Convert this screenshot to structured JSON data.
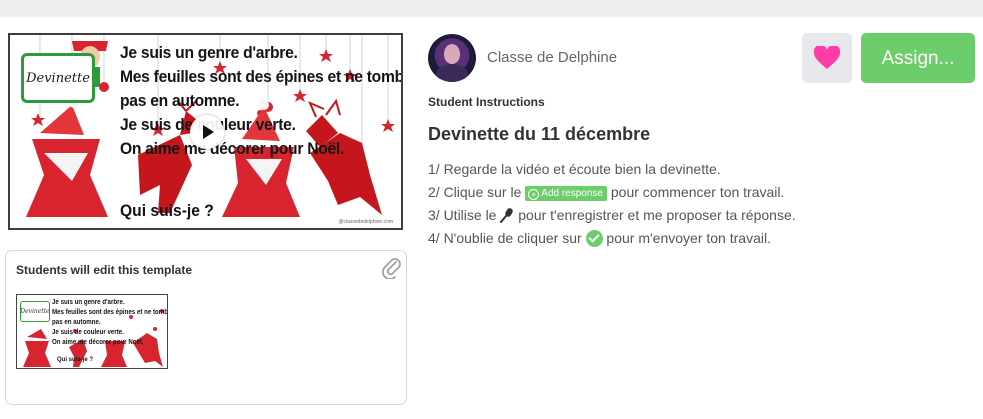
{
  "video": {
    "label": "Devinette",
    "lines": [
      "Je suis un genre d'arbre.",
      "Mes feuilles sont des épines et ne tombent",
      "pas en automne.",
      "Je suis de couleur verte.",
      "On aime me décorer pour Noël."
    ],
    "question": "Qui suis-je ?",
    "credit": "@classededelphine.com"
  },
  "template": {
    "title": "Students will edit this template",
    "thumb_label": "Devinette",
    "thumb_lines": [
      "Je suis un genre d'arbre.",
      "Mes feuilles sont des épines et ne tombent",
      "pas en automne.",
      "Je suis de couleur verte.",
      "On aime me décorer pour Noël."
    ],
    "thumb_question": "Qui suis-je ?"
  },
  "author": {
    "name": "Classe de Delphine"
  },
  "actions": {
    "assign_label": "Assign..."
  },
  "instructions": {
    "label": "Student Instructions",
    "title": "Devinette du 11 décembre",
    "step1": "1/ Regarde la vidéo et écoute bien la devinette.",
    "step2_pre": "2/ Clique sur le ",
    "step2_chip": "Add response",
    "step2_post": " pour commencer ton travail.",
    "step3_pre": "3/ Utilise le ",
    "step3_post": " pour t'enregistrer et me proposer ta réponse.",
    "step4_pre": "4/ N'oublie de cliquer sur ",
    "step4_post": " pour m'envoyer ton travail."
  },
  "colors": {
    "accent_green": "#6bce6b",
    "heart_pink": "#ff3da8",
    "ornament_red": "#d8242f"
  }
}
